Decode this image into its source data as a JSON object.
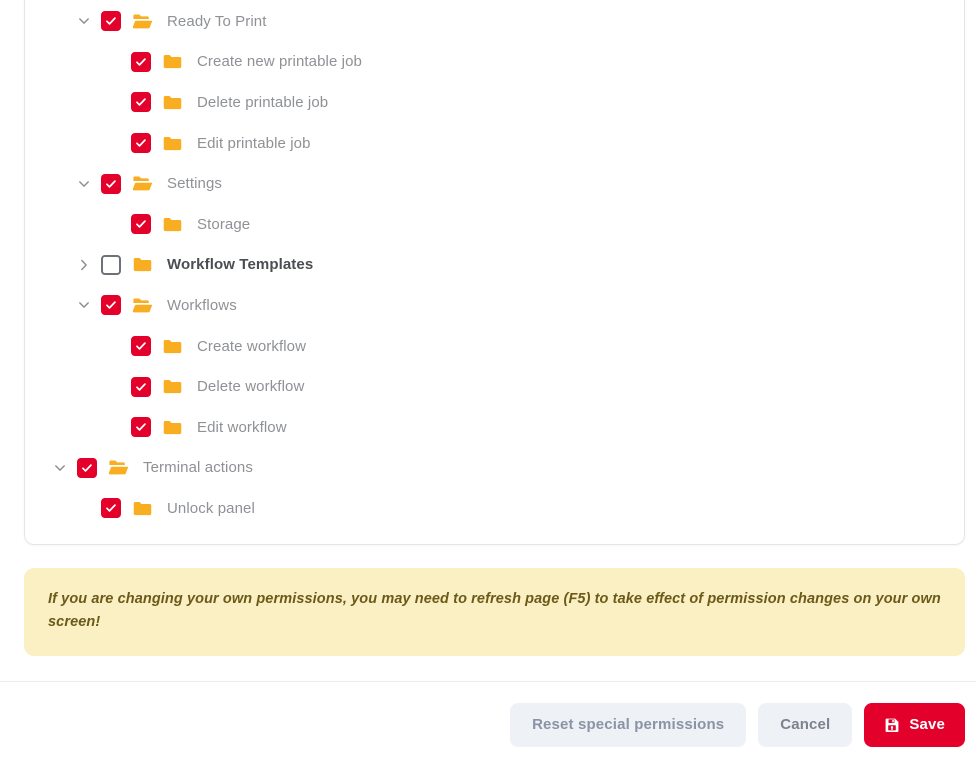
{
  "tree": {
    "items": [
      {
        "label": "Ready To Print",
        "level": 1,
        "checked": true,
        "expander": "chevron-down-icon",
        "folder": "folder-open-icon",
        "emphasis": false
      },
      {
        "label": "Create new printable job",
        "level": 2,
        "checked": true,
        "expander": "none",
        "folder": "folder-closed-icon",
        "emphasis": false
      },
      {
        "label": "Delete printable job",
        "level": 2,
        "checked": true,
        "expander": "none",
        "folder": "folder-closed-icon",
        "emphasis": false
      },
      {
        "label": "Edit printable job",
        "level": 2,
        "checked": true,
        "expander": "none",
        "folder": "folder-closed-icon",
        "emphasis": false
      },
      {
        "label": "Settings",
        "level": 1,
        "checked": true,
        "expander": "chevron-down-icon",
        "folder": "folder-open-icon",
        "emphasis": false
      },
      {
        "label": "Storage",
        "level": 2,
        "checked": true,
        "expander": "none",
        "folder": "folder-closed-icon",
        "emphasis": false
      },
      {
        "label": "Workflow Templates",
        "level": 1,
        "checked": false,
        "expander": "chevron-right-icon",
        "folder": "folder-closed-icon",
        "emphasis": true
      },
      {
        "label": "Workflows",
        "level": 1,
        "checked": true,
        "expander": "chevron-down-icon",
        "folder": "folder-open-icon",
        "emphasis": false
      },
      {
        "label": "Create workflow",
        "level": 2,
        "checked": true,
        "expander": "none",
        "folder": "folder-closed-icon",
        "emphasis": false
      },
      {
        "label": "Delete workflow",
        "level": 2,
        "checked": true,
        "expander": "none",
        "folder": "folder-closed-icon",
        "emphasis": false
      },
      {
        "label": "Edit workflow",
        "level": 2,
        "checked": true,
        "expander": "none",
        "folder": "folder-closed-icon",
        "emphasis": false
      },
      {
        "label": "Terminal actions",
        "level": 0,
        "checked": true,
        "expander": "chevron-down-icon",
        "folder": "folder-open-icon",
        "emphasis": false
      },
      {
        "label": "Unlock panel",
        "level": 1,
        "checked": true,
        "expander": "none",
        "folder": "folder-closed-icon",
        "emphasis": false
      }
    ]
  },
  "note": {
    "text": "If you are changing your own permissions, you may need to refresh page (F5) to take effect of permission changes on your own screen!"
  },
  "footer": {
    "reset_label": "Reset special permissions",
    "cancel_label": "Cancel",
    "save_label": "Save",
    "save_icon": "save-floppy-icon"
  },
  "colors": {
    "accent_red": "#e3002b",
    "folder_orange": "#f9ad20",
    "note_bg": "#fbf0c4",
    "note_text": "#6b5a18",
    "button_grey_bg": "#eef1f6",
    "label_grey": "#8e9195",
    "label_emphasis": "#4a4d52"
  }
}
